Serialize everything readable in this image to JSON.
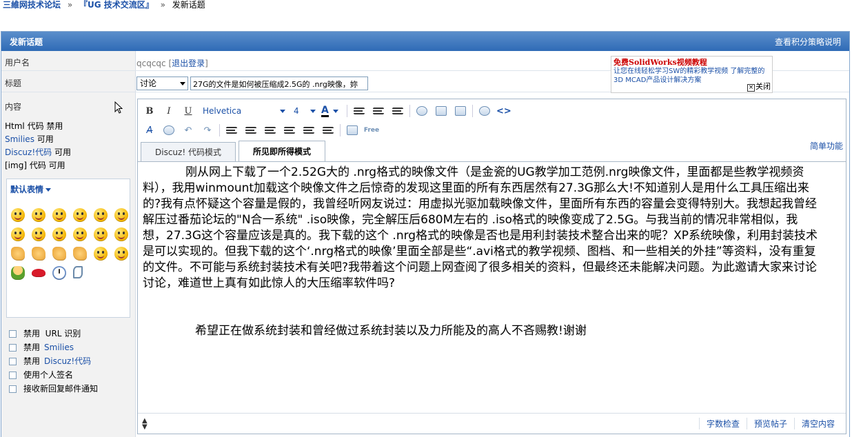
{
  "breadcrumb": {
    "forum": "三維网技术论坛",
    "section": "『UG 技术交流区』",
    "sep": "»",
    "current": "发新话题"
  },
  "header": {
    "title": "发新话题",
    "help_link": "查看积分策略说明"
  },
  "user": {
    "label": "用户名",
    "name": "qcqcqc",
    "logout": "退出登录"
  },
  "subject": {
    "label": "标题",
    "type": "讨论",
    "value": "27G的文件是如何被压缩成2.5G的 .nrg映像，妳"
  },
  "promo": {
    "title": "免费SolidWorks视频教程",
    "text": "让您在线轻松学习SW的精彩教学视频 了解完整的3D MCAD产品设计解决方案",
    "close": "关闭"
  },
  "content": {
    "label": "内容",
    "html_code": "Html 代码",
    "html_state": "禁用",
    "smilies": "Smilies",
    "smilies_state": "可用",
    "discuz": "Discuz!代码",
    "discuz_state": "可用",
    "img": "[img] 代码",
    "img_state": "可用"
  },
  "smilies_panel": {
    "title": "默认表情"
  },
  "options": {
    "disable": "禁用",
    "url": "URL 识别",
    "smilies": "Smilies",
    "discuz": "Discuz!代码",
    "signature": "使用个人签名",
    "notify": "接收新回复邮件通知"
  },
  "toolbar": {
    "bold": "B",
    "italic": "I",
    "underline": "U",
    "font": "Helvetica",
    "size": "4",
    "color": "A",
    "free": "Free"
  },
  "tabs": {
    "code": "Discuz! 代码模式",
    "wysiwyg": "所见即所得模式",
    "simple": "简单功能"
  },
  "body": {
    "p1": "刚从网上下载了一个2.52G大的 .nrg格式的映像文件（是金瓷的UG教学加工范例.nrg映像文件，里面都是些教学视频资料），我用winmount加载这个映像文件之后惊奇的发现这里面的所有东西居然有27.3G那么大!不知道别人是用什么工具压缩出来的?我有点怀疑这个容量是假的，我曾经听网友说过：用虚拟光驱加载映像文件，里面所有东西的容量会变得特别大。我想起我曾经解压过番茄论坛的\"N合一系统\" .iso映像，完全解压后680M左右的 .iso格式的映像变成了2.5G。与我当前的情况非常相似，我想，27.3G这个容量应该是真的。我下载的这个 .nrg格式的映像是否也是用利封装技术整合出来的呢？XP系统映像，利用封装技术是可以实现的。但我下载的这个‘.nrg格式的映像’里面全部是些“.avi格式的教学视频、图档、和一些相关的外挂”等资料，没有重复的文件。不可能与系统封装技术有关吧?我带着这个问题上网查阅了很多相关的资料，但最终还未能解决问题。为此邀请大家来讨论讨论，难道世上真有如此惊人的大压缩率软件吗?",
    "p2": "希望正在做系统封装和曾经做过系统封装以及力所能及的高人不吝赐教!谢谢"
  },
  "footer": {
    "count": "字数检查",
    "preview": "预览帖子",
    "clear": "清空内容"
  }
}
